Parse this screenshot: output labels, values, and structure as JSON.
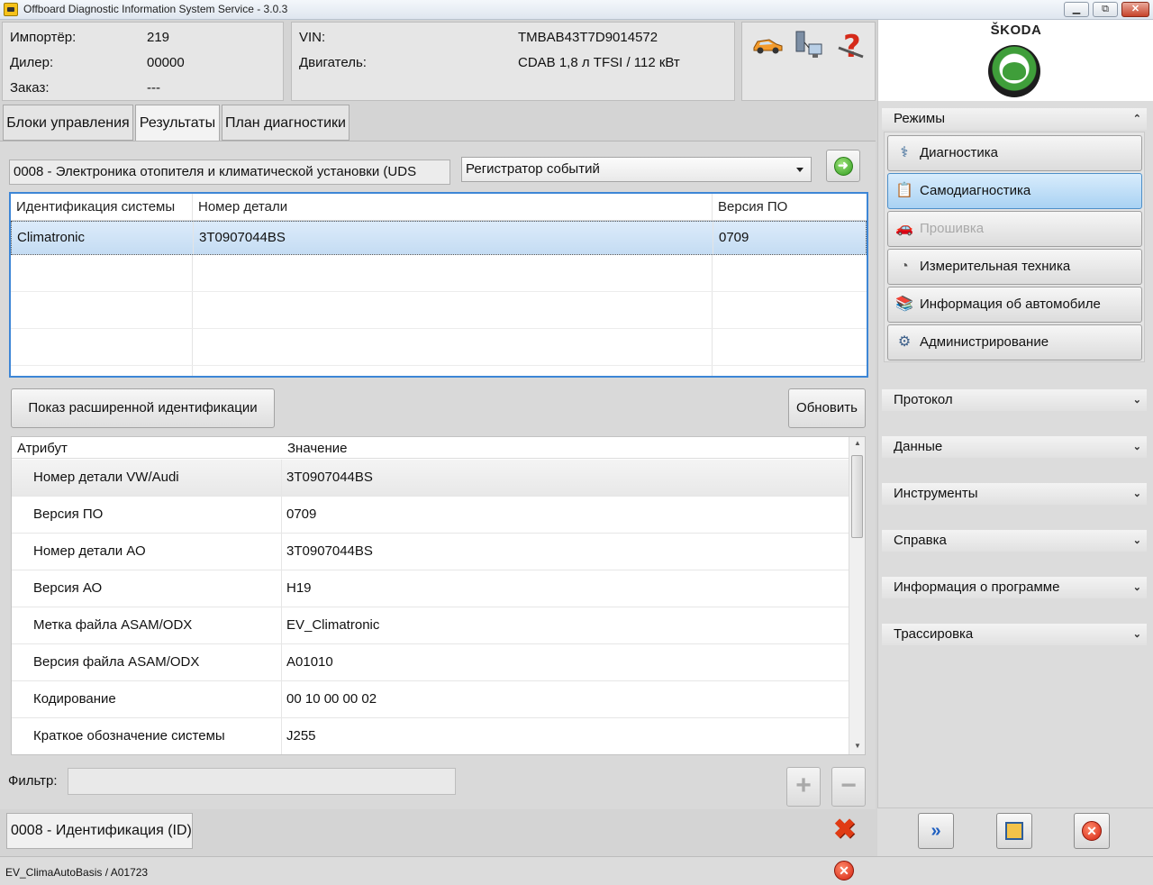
{
  "window": {
    "title": "Offboard Diagnostic Information System Service - 3.0.3",
    "min_label": "▭",
    "restore_label": "⧉",
    "close_label": "✕"
  },
  "header": {
    "importer_label": "Импортёр:",
    "importer_value": "219",
    "dealer_label": "Дилер:",
    "dealer_value": "00000",
    "order_label": "Заказ:",
    "order_value": "---",
    "vin_label": "VIN:",
    "vin_value": "TMBAB43T7D9014572",
    "engine_label": "Двигатель:",
    "engine_value": "CDAB 1,8 л TFSI / 112 кВт",
    "brand": "ŠKODA",
    "icons": [
      "car-icon",
      "network-icon",
      "help-icon"
    ]
  },
  "tabs": [
    {
      "label": "Блоки управления",
      "active": false
    },
    {
      "label": "Результаты",
      "active": true
    },
    {
      "label": "План диагностики",
      "active": false
    }
  ],
  "ecu": {
    "name": "0008 - Электроника отопителя и климатической установки  (UDS",
    "selected_function": "Регистратор событий"
  },
  "system_table": {
    "columns": [
      "Идентификация системы",
      "Номер детали",
      "Версия ПО"
    ],
    "rows": [
      [
        "Climatronic",
        "3T0907044BS",
        "0709"
      ]
    ]
  },
  "buttons": {
    "extended_id": "Показ расширенной идентификации",
    "refresh": "Обновить"
  },
  "attributes": {
    "columns": [
      "Атрибут",
      "Значение"
    ],
    "rows": [
      {
        "attr": "Номер детали VW/Audi",
        "value": "3T0907044BS"
      },
      {
        "attr": "Версия ПО",
        "value": "0709"
      },
      {
        "attr": "Номер детали АО",
        "value": "3T0907044BS"
      },
      {
        "attr": "Версия АО",
        "value": "H19"
      },
      {
        "attr": "Метка файла ASAM/ODX",
        "value": "EV_Climatronic"
      },
      {
        "attr": "Версия файла ASAM/ODX",
        "value": "A01010"
      },
      {
        "attr": "Кодирование",
        "value": "00 10 00 00 02"
      },
      {
        "attr": "Краткое обозначение системы",
        "value": "J255"
      }
    ]
  },
  "filter": {
    "label": "Фильтр:",
    "value": "",
    "plus_label": "+",
    "minus_label": "−"
  },
  "bottom_tab": {
    "label": "0008 - Идентификация (ID)"
  },
  "status": {
    "text": "EV_ClimaAutoBasis / A01723"
  },
  "right_panel": {
    "modes_title": "Режимы",
    "modes": [
      {
        "label": "Диагностика",
        "icon": "stethoscope-icon",
        "state": "normal"
      },
      {
        "label": "Самодиагностика",
        "icon": "clipboard-icon",
        "state": "active"
      },
      {
        "label": "Прошивка",
        "icon": "car-flash-icon",
        "state": "disabled"
      },
      {
        "label": "Измерительная техника",
        "icon": "gauge-icon",
        "state": "normal"
      },
      {
        "label": "Информация об автомобиле",
        "icon": "books-icon",
        "state": "normal"
      },
      {
        "label": "Администрирование",
        "icon": "gear-icon",
        "state": "normal"
      }
    ],
    "sections": [
      "Протокол",
      "Данные",
      "Инструменты",
      "Справка",
      "Информация о программе",
      "Трассировка"
    ],
    "collapse_glyph": "⌃",
    "expand_glyph": "⌄"
  },
  "colors": {
    "accent_blue": "#3d86d6",
    "active_mode": "#a9d2f3",
    "error_red": "#e03b14"
  }
}
